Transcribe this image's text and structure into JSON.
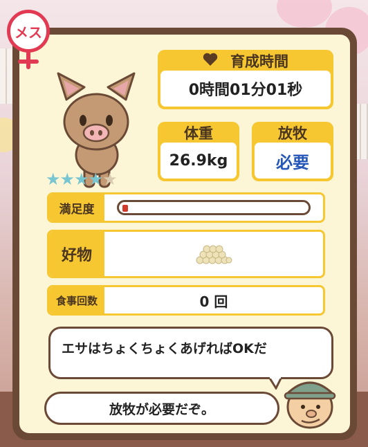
{
  "gender_badge": {
    "label": "メス"
  },
  "pet": {
    "stars_filled": 4,
    "stars_total": 5,
    "star_filled_glyph": "★",
    "star_empty_glyph": "★"
  },
  "growth_time": {
    "icon": "heart-icon",
    "title": "育成時間",
    "value": "0時間01分01秒"
  },
  "weight": {
    "title": "体重",
    "value": "26.9kg"
  },
  "grazing": {
    "title": "放牧",
    "value": "必要"
  },
  "satisfaction": {
    "label": "満足度",
    "level": 0.03
  },
  "favorite_food": {
    "label": "好物",
    "icon": "feed-pile-icon"
  },
  "meal_count": {
    "label": "食事回数",
    "value": "0 回"
  },
  "messages": {
    "hint": "エサはちょくちょくあげればOKだ",
    "farmer": "放牧が必要だぞ。"
  },
  "colors": {
    "panel_border": "#6a4a36",
    "card_yellow": "#f6c731",
    "panel_bg": "#fdf6d6",
    "badge_red": "#e23a53",
    "accent_blue": "#2457b8"
  }
}
